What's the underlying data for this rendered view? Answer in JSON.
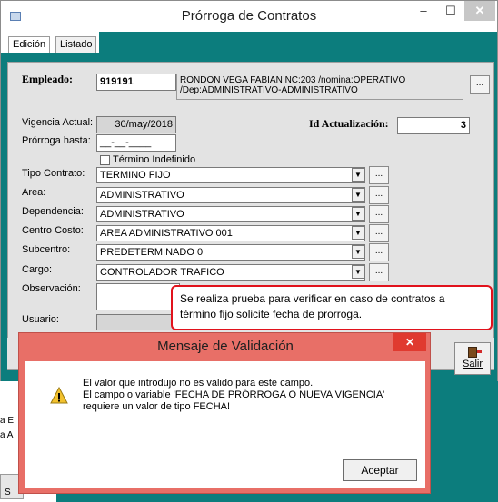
{
  "window": {
    "title": "Prórroga de Contratos",
    "minimize": "–",
    "maximize": "☐",
    "close": "✕"
  },
  "tabs": [
    {
      "label": "Edición",
      "active": true
    },
    {
      "label": "Listado",
      "active": false
    }
  ],
  "form": {
    "empleado_label": "Empleado:",
    "empleado_value": "919191",
    "empleado_desc_line1": "RONDON VEGA FABIAN NC:203 /nomina:OPERATIVO",
    "empleado_desc_line2": "/Dep:ADMINISTRATIVO-ADMINISTRATIVO",
    "vigencia_label": "Vigencia Actual:",
    "vigencia_value": "30/may/2018",
    "id_actualizacion_label": "Id Actualización:",
    "id_actualizacion_value": "3",
    "prorroga_label": "Prórroga hasta:",
    "prorroga_value": "__-__-____",
    "termino_indefinido_label": "Término Indefinido",
    "tipo_contrato_label": "Tipo Contrato:",
    "tipo_contrato_value": "TERMINO FIJO",
    "area_label": "Area:",
    "area_value": "ADMINISTRATIVO",
    "dependencia_label": "Dependencia:",
    "dependencia_value": "ADMINISTRATIVO",
    "centro_costo_label": "Centro Costo:",
    "centro_costo_value": "AREA ADMINISTRATIVO 001",
    "subcentro_label": "Subcentro:",
    "subcentro_value": "PREDETERMINADO 0",
    "cargo_label": "Cargo:",
    "cargo_value": "CONTROLADOR TRAFICO",
    "observacion_label": "Observación:",
    "usuario_label": "Usuario:",
    "dots_label": "...",
    "dropdown_arrow": "▼"
  },
  "salir_label": "Salir",
  "callout_text": "Se realiza prueba para verificar en caso de contratos a término fijo solicite fecha de prorroga.",
  "dialog": {
    "title": "Mensaje de Validación",
    "close": "✕",
    "line1": "El valor que introdujo no es válido para este campo.",
    "line2": "El campo o variable 'FECHA DE PRÓRROGA O NUEVA VIGENCIA'",
    "line3": "requiere un valor de tipo FECHA!",
    "accept_label": "Aceptar",
    "icon": "warning-icon"
  },
  "background": {
    "left_text_1": "a E",
    "left_text_2": "a A",
    "left_btn_text": "S"
  },
  "colors": {
    "teal": "#0c7d7d",
    "dialog_frame": "#e86f67",
    "callout_border": "#e1121c"
  }
}
